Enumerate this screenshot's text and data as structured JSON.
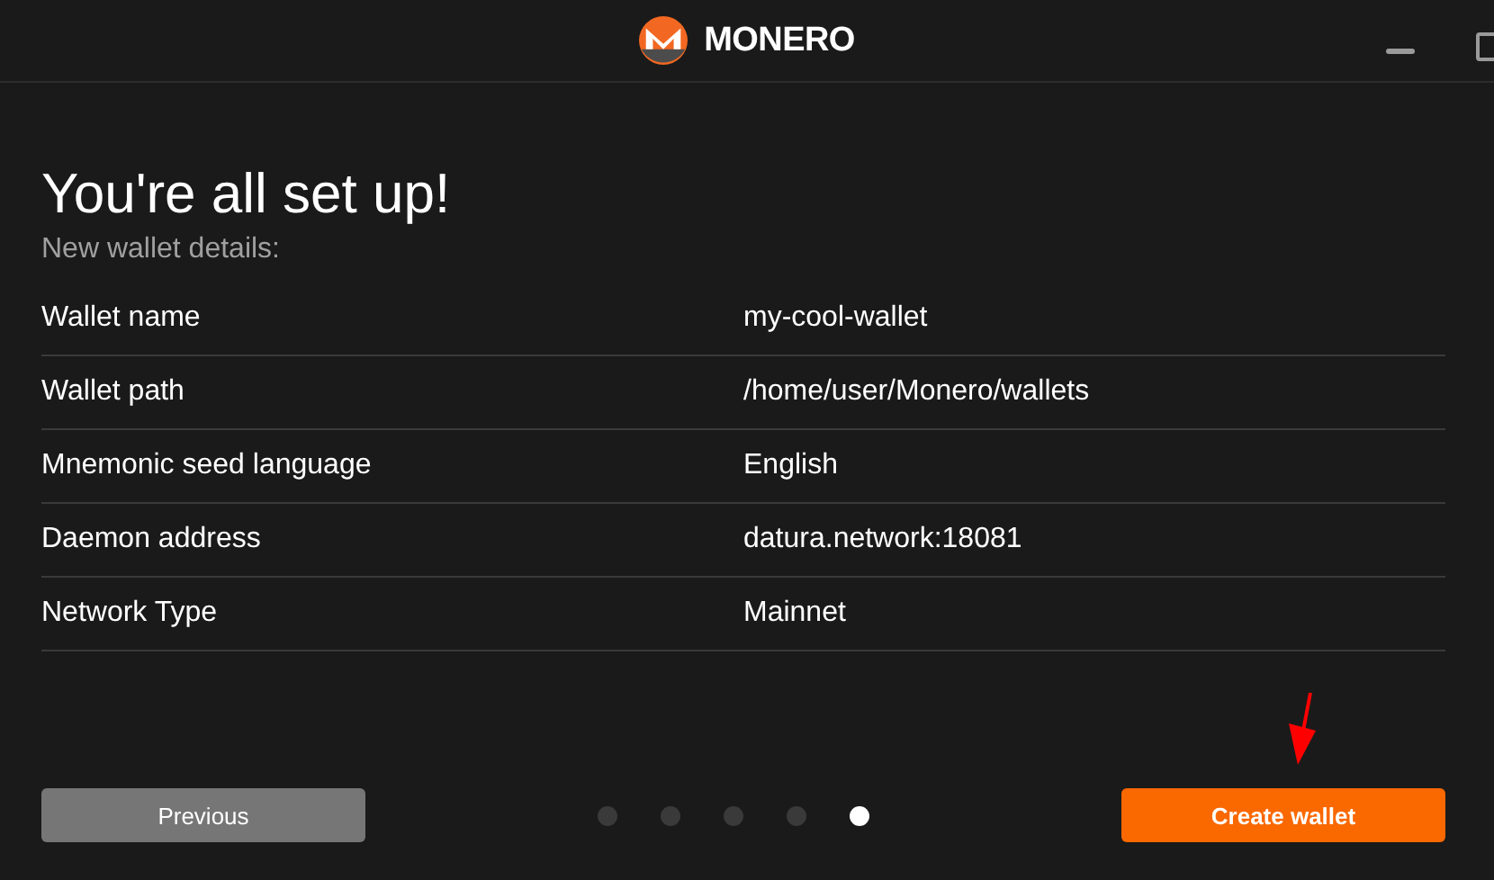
{
  "titlebar": {
    "logo_text": "MONERO"
  },
  "heading": "You're all set up!",
  "subheading": "New wallet details:",
  "details": [
    {
      "label": "Wallet name",
      "value": "my-cool-wallet"
    },
    {
      "label": "Wallet path",
      "value": "/home/user/Monero/wallets"
    },
    {
      "label": "Mnemonic seed language",
      "value": "English"
    },
    {
      "label": "Daemon address",
      "value": "datura.network:18081"
    },
    {
      "label": "Network Type",
      "value": "Mainnet"
    }
  ],
  "footer": {
    "previous": "Previous",
    "create": "Create wallet",
    "steps": [
      {
        "selected": false
      },
      {
        "selected": false
      },
      {
        "selected": false
      },
      {
        "selected": false
      },
      {
        "selected": true
      }
    ]
  }
}
